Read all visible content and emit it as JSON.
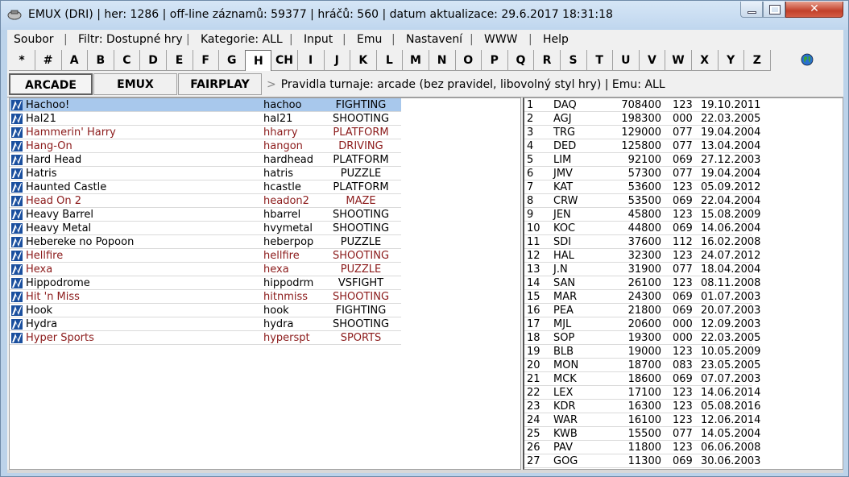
{
  "window": {
    "title": "EMUX (DRI)  |  her: 1286  |  off-line záznamů: 59377  |  hráčů: 560  |  datum aktualizace: 29.6.2017 18:31:18",
    "close_glyph": "✕"
  },
  "menu": [
    "Soubor",
    "Filtr: Dostupné hry",
    "Kategorie: ALL",
    "Input",
    "Emu",
    "Nastavení",
    "WWW",
    "Help"
  ],
  "letters": [
    "*",
    "#",
    "A",
    "B",
    "C",
    "D",
    "E",
    "F",
    "G",
    "H",
    "CH",
    "I",
    "J",
    "K",
    "L",
    "M",
    "N",
    "O",
    "P",
    "Q",
    "R",
    "S",
    "T",
    "U",
    "V",
    "W",
    "X",
    "Y",
    "Z"
  ],
  "active_letter": "H",
  "tabs": [
    "ARCADE",
    "EMUX",
    "FAIRPLAY"
  ],
  "active_tab": "ARCADE",
  "rules_separator": ">",
  "rules_text": "Pravidla turnaje: arcade (bez pravidel, libovolný styl hry) | Emu: ALL",
  "games": [
    {
      "name": "Hachoo!",
      "code": "hachoo",
      "category": "FIGHTING",
      "red": false,
      "selected": true
    },
    {
      "name": "Hal21",
      "code": "hal21",
      "category": "SHOOTING",
      "red": false
    },
    {
      "name": "Hammerin' Harry",
      "code": "hharry",
      "category": "PLATFORM",
      "red": true
    },
    {
      "name": "Hang-On",
      "code": "hangon",
      "category": "DRIVING",
      "red": true
    },
    {
      "name": "Hard Head",
      "code": "hardhead",
      "category": "PLATFORM",
      "red": false
    },
    {
      "name": "Hatris",
      "code": "hatris",
      "category": "PUZZLE",
      "red": false
    },
    {
      "name": "Haunted Castle",
      "code": "hcastle",
      "category": "PLATFORM",
      "red": false
    },
    {
      "name": "Head On 2",
      "code": "headon2",
      "category": "MAZE",
      "red": true
    },
    {
      "name": "Heavy Barrel",
      "code": "hbarrel",
      "category": "SHOOTING",
      "red": false
    },
    {
      "name": "Heavy Metal",
      "code": "hvymetal",
      "category": "SHOOTING",
      "red": false
    },
    {
      "name": "Hebereke no Popoon",
      "code": "heberpop",
      "category": "PUZZLE",
      "red": false
    },
    {
      "name": "Hellfire",
      "code": "hellfire",
      "category": "SHOOTING",
      "red": true
    },
    {
      "name": "Hexa",
      "code": "hexa",
      "category": "PUZZLE",
      "red": true
    },
    {
      "name": "Hippodrome",
      "code": "hippodrm",
      "category": "VSFIGHT",
      "red": false
    },
    {
      "name": "Hit 'n Miss",
      "code": "hitnmiss",
      "category": "SHOOTING",
      "red": true
    },
    {
      "name": "Hook",
      "code": "hook",
      "category": "FIGHTING",
      "red": false
    },
    {
      "name": "Hydra",
      "code": "hydra",
      "category": "SHOOTING",
      "red": false
    },
    {
      "name": "Hyper Sports",
      "code": "hyperspt",
      "category": "SPORTS",
      "red": true
    }
  ],
  "scores": [
    [
      "1",
      "DAQ",
      "708400",
      "123",
      "19.10.2011"
    ],
    [
      "2",
      "AGJ",
      "198300",
      "000",
      "22.03.2005"
    ],
    [
      "3",
      "TRG",
      "129000",
      "077",
      "19.04.2004"
    ],
    [
      "4",
      "DED",
      "125800",
      "077",
      "13.04.2004"
    ],
    [
      "5",
      "LIM",
      "92100",
      "069",
      "27.12.2003"
    ],
    [
      "6",
      "JMV",
      "57300",
      "077",
      "19.04.2004"
    ],
    [
      "7",
      "KAT",
      "53600",
      "123",
      "05.09.2012"
    ],
    [
      "8",
      "CRW",
      "53500",
      "069",
      "22.04.2004"
    ],
    [
      "9",
      "JEN",
      "45800",
      "123",
      "15.08.2009"
    ],
    [
      "10",
      "KOC",
      "44800",
      "069",
      "14.06.2004"
    ],
    [
      "11",
      "SDI",
      "37600",
      "112",
      "16.02.2008"
    ],
    [
      "12",
      "HAL",
      "32300",
      "123",
      "24.07.2012"
    ],
    [
      "13",
      "J.N",
      "31900",
      "077",
      "18.04.2004"
    ],
    [
      "14",
      "SAN",
      "26100",
      "123",
      "08.11.2008"
    ],
    [
      "15",
      "MAR",
      "24300",
      "069",
      "01.07.2003"
    ],
    [
      "16",
      "PEA",
      "21800",
      "069",
      "20.07.2003"
    ],
    [
      "17",
      "MJL",
      "20600",
      "000",
      "12.09.2003"
    ],
    [
      "18",
      "SOP",
      "19300",
      "000",
      "22.03.2005"
    ],
    [
      "19",
      "BLB",
      "19000",
      "123",
      "10.05.2009"
    ],
    [
      "20",
      "MON",
      "18700",
      "083",
      "23.05.2005"
    ],
    [
      "21",
      "MCK",
      "18600",
      "069",
      "07.07.2003"
    ],
    [
      "22",
      "LEX",
      "17100",
      "123",
      "14.06.2014"
    ],
    [
      "23",
      "KDR",
      "16300",
      "123",
      "05.08.2016"
    ],
    [
      "24",
      "WAR",
      "16100",
      "123",
      "12.06.2014"
    ],
    [
      "25",
      "KWB",
      "15500",
      "077",
      "14.05.2004"
    ],
    [
      "26",
      "PAV",
      "11800",
      "123",
      "06.06.2008"
    ],
    [
      "27",
      "GOG",
      "11300",
      "069",
      "30.06.2003"
    ]
  ],
  "colors": {
    "selection": "#a8c8ec",
    "missing_game_text": "#8b1a1a",
    "game_icon": "#1a4f9e",
    "close_button": "#c2402a"
  },
  "icons": {
    "app": "emux-app-icon",
    "game": "game-icon",
    "web": "globe-icon"
  }
}
